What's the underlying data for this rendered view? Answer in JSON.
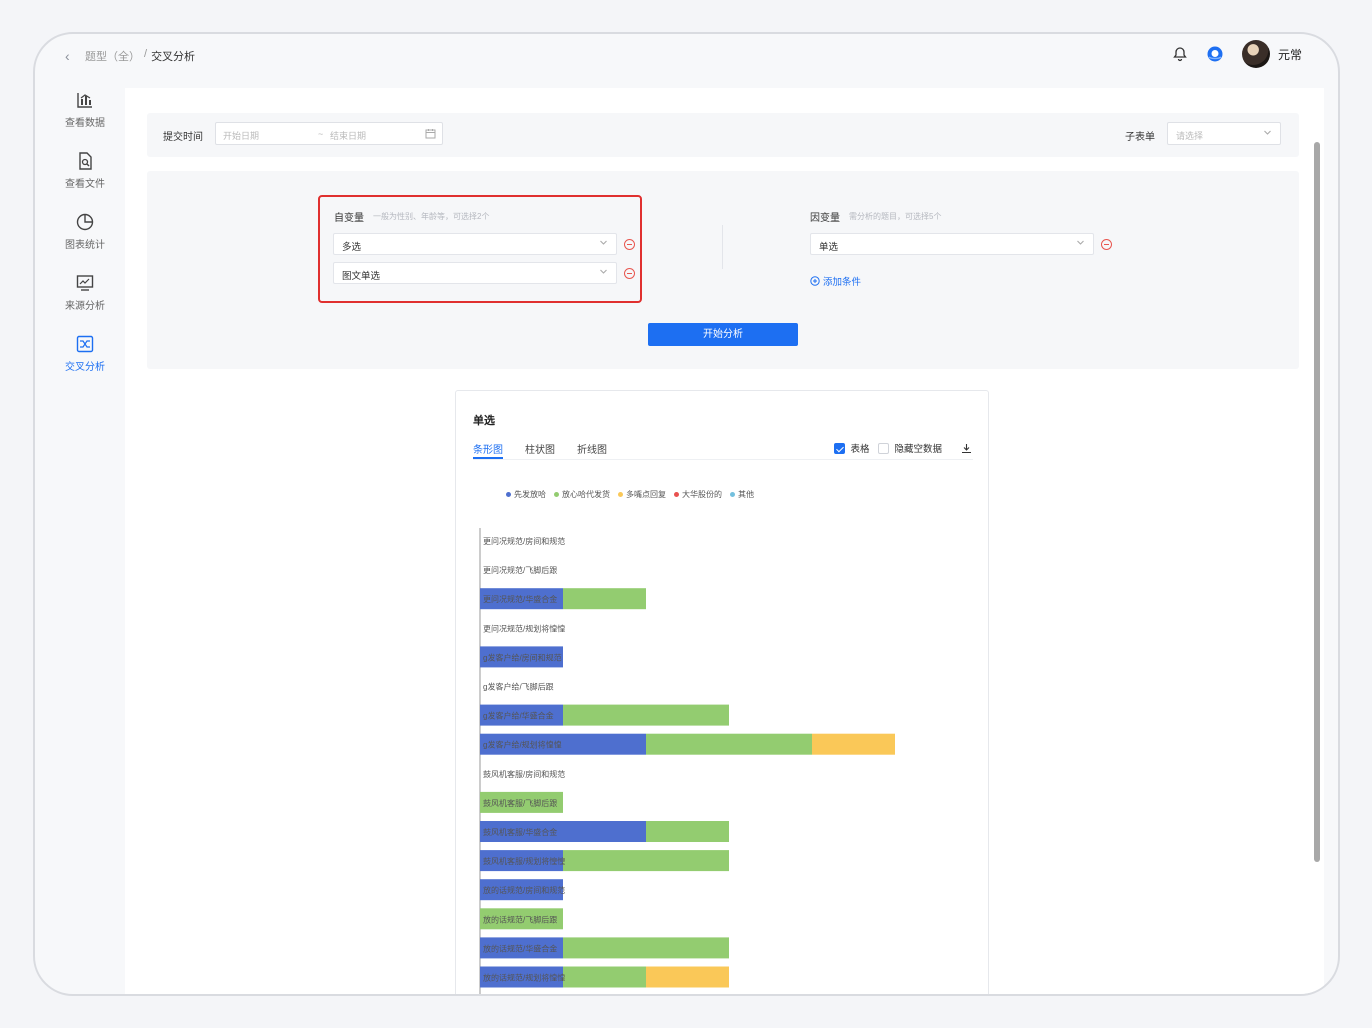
{
  "breadcrumb": {
    "parent": "题型（全）",
    "sep": "/",
    "current": "交叉分析"
  },
  "user": {
    "name": "元常"
  },
  "sidebar": {
    "items": [
      {
        "label": "查看数据",
        "icon": "bar-chart-icon"
      },
      {
        "label": "查看文件",
        "icon": "file-search-icon"
      },
      {
        "label": "图表统计",
        "icon": "pie-chart-icon"
      },
      {
        "label": "来源分析",
        "icon": "monitor-chart-icon"
      },
      {
        "label": "交叉分析",
        "icon": "cross-analysis-icon",
        "active": true
      }
    ]
  },
  "filter": {
    "time_label": "提交时间",
    "start_placeholder": "开始日期",
    "range_sep": "~",
    "end_placeholder": "结束日期",
    "subform_label": "子表单",
    "subform_placeholder": "请选择"
  },
  "conditions": {
    "independent_label": "自变量",
    "independent_hint": "一般为性别、年龄等，可选择2个",
    "independent_values": [
      "多选",
      "图文单选"
    ],
    "dependent_label": "因变量",
    "dependent_hint": "需分析的题目，可选择5个",
    "dependent_values": [
      "单选"
    ],
    "add_condition": "添加条件",
    "start_button": "开始分析"
  },
  "result": {
    "title": "单选",
    "tabs": [
      "条形图",
      "柱状图",
      "折线图"
    ],
    "active_tab": "条形图",
    "table_toggle": "表格",
    "table_checked": true,
    "hide_empty": "隐藏空数据",
    "hide_empty_checked": false
  },
  "chart_data": {
    "type": "bar",
    "orientation": "horizontal",
    "stacked": true,
    "legend_position": "top",
    "series": [
      {
        "name": "先发放哈",
        "color": "#4e6fcf"
      },
      {
        "name": "放心哈代发货",
        "color": "#93cc70"
      },
      {
        "name": "多嘴点回复",
        "color": "#fac858"
      },
      {
        "name": "大华股份的",
        "color": "#e8514f"
      },
      {
        "name": "其他",
        "color": "#73c0de"
      }
    ],
    "categories": [
      "更问况规范/房间和规范",
      "更问况规范/飞脚后跟",
      "更问况规范/华盛合金",
      "更问况规范/规划将惶惶",
      "g发客户给/房间和规范",
      "g发客户给/飞脚后跟",
      "g发客户给/华盛合金",
      "g发客户给/规划将惶惶",
      "鼓风机客服/房间和规范",
      "鼓风机客服/飞脚后跟",
      "鼓风机客服/华盛合金",
      "鼓风机客服/规划将惶惶",
      "放的话规范/房间和规范",
      "放的话规范/飞脚后跟",
      "放的话规范/华盛合金",
      "放的话规范/规划将惶惶"
    ],
    "values": [
      [
        0,
        0,
        0,
        0,
        0
      ],
      [
        0,
        0,
        0,
        0,
        0
      ],
      [
        1,
        1,
        0,
        0,
        0
      ],
      [
        0,
        0,
        0,
        0,
        0
      ],
      [
        1,
        0,
        0,
        0,
        0
      ],
      [
        0,
        0,
        0,
        0,
        0
      ],
      [
        1,
        2,
        0,
        0,
        0
      ],
      [
        2,
        2,
        1,
        0,
        0
      ],
      [
        0,
        0,
        0,
        0,
        0
      ],
      [
        0,
        1,
        0,
        0,
        0
      ],
      [
        2,
        1,
        0,
        0,
        0
      ],
      [
        1,
        2,
        0,
        0,
        0
      ],
      [
        1,
        0,
        0,
        0,
        0
      ],
      [
        0,
        1,
        0,
        0,
        0
      ],
      [
        1,
        2,
        0,
        0,
        0
      ],
      [
        1,
        1,
        1,
        0,
        0
      ]
    ]
  }
}
